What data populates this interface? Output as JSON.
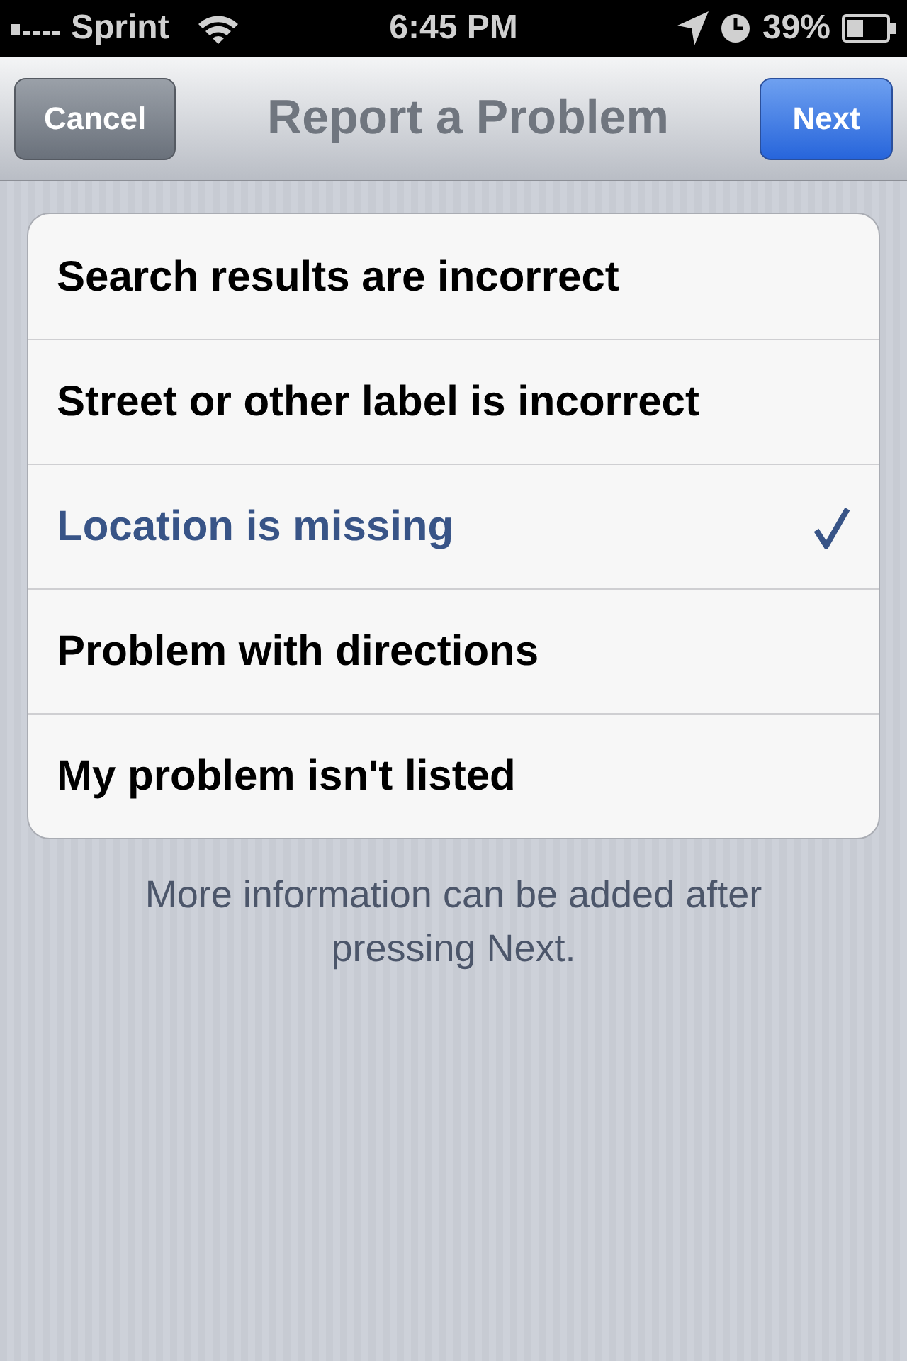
{
  "status_bar": {
    "carrier": "Sprint",
    "time": "6:45 PM",
    "battery": "39%"
  },
  "nav_bar": {
    "cancel": "Cancel",
    "title": "Report a Problem",
    "next": "Next"
  },
  "options": [
    {
      "label": "Search results are incorrect",
      "selected": false
    },
    {
      "label": "Street or other label is incorrect",
      "selected": false
    },
    {
      "label": "Location is missing",
      "selected": true
    },
    {
      "label": "Problem with directions",
      "selected": false
    },
    {
      "label": "My problem isn't listed",
      "selected": false
    }
  ],
  "footer_note": "More information can be added after pressing Next."
}
